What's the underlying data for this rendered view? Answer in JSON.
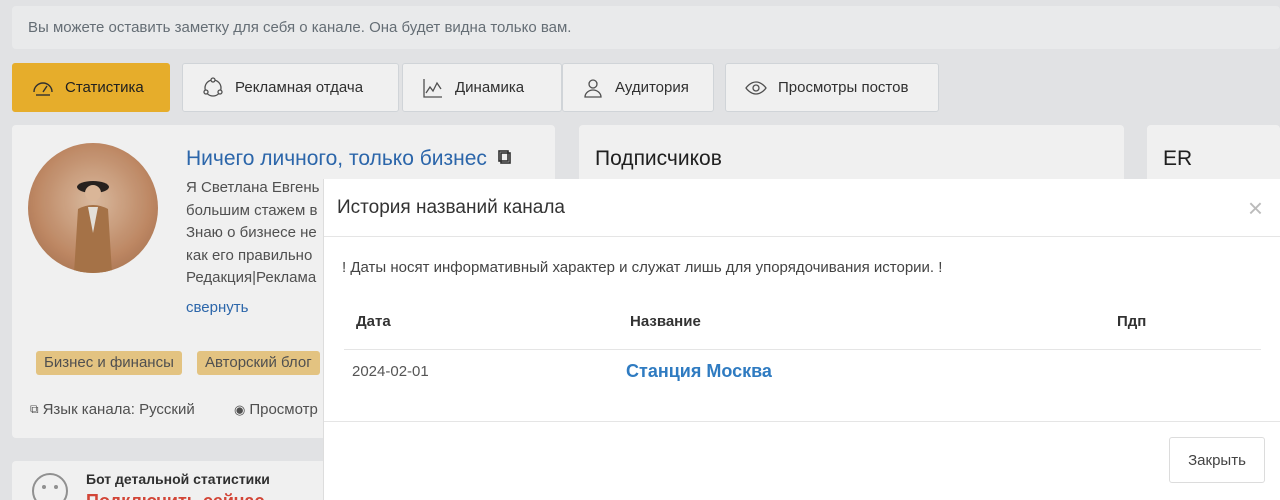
{
  "note_bar": {
    "text": "Вы можете оставить заметку для себя о канале. Она будет видна только вам."
  },
  "tabs": [
    {
      "label": "Статистика",
      "icon": "gauge-icon",
      "active": true
    },
    {
      "label": "Рекламная отдача",
      "icon": "cycle-icon",
      "active": false
    },
    {
      "label": "Динамика",
      "icon": "line-chart-icon",
      "active": false
    },
    {
      "label": "Аудитория",
      "icon": "users-icon",
      "active": false
    },
    {
      "label": "Просмотры постов",
      "icon": "eye-icon",
      "active": false
    }
  ],
  "channel": {
    "title": "Ничего личного, только бизнес",
    "desc_lines": [
      "Я Светлана Евгень",
      "большим стажем в",
      "Знаю о бизнесе не",
      "как его правильно",
      "Редакция|Реклама"
    ],
    "collapse_label": "свернуть",
    "tags": [
      "Бизнес и финансы",
      "Авторский блог"
    ],
    "language": "Язык канала: Русский",
    "views": "Просмотр"
  },
  "subscribers_card": {
    "heading": "Подписчиков"
  },
  "er_card": {
    "heading": "ER"
  },
  "bot_card": {
    "label": "Бот детальной статистики",
    "cta": "Подключить сейчас"
  },
  "modal": {
    "title": "История названий канала",
    "note": "! Даты носят информативный характер и служат лишь для упорядочивания истории. !",
    "columns": {
      "date": "Дата",
      "name": "Название",
      "pdp": "Пдп"
    },
    "rows": [
      {
        "date": "2024-02-01",
        "name": "Станция Москва",
        "pdp": ""
      }
    ],
    "close_button": "Закрыть",
    "close_icon": "×"
  },
  "colors": {
    "accent": "#f5b82e",
    "link": "#2f7bc1",
    "cta": "#e04a3b"
  }
}
